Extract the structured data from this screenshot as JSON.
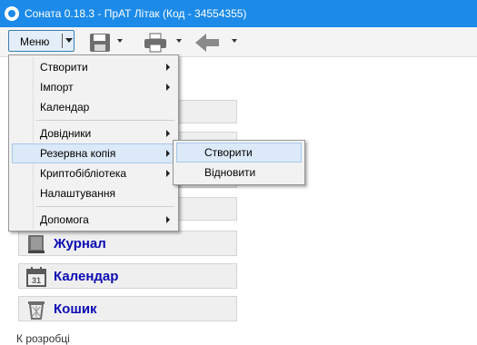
{
  "window": {
    "title": "Соната 0.18.3 - ПрАТ Літак (Код - 34554355)"
  },
  "toolbar": {
    "menu_label": "Меню",
    "icons": [
      "save-icon",
      "print-icon",
      "back-arrow-icon"
    ]
  },
  "panels": [
    {
      "label": "Журнал",
      "icon": "journal-icon"
    },
    {
      "label": "Календар",
      "icon": "calendar-icon"
    },
    {
      "label": "Кошик",
      "icon": "trash-icon"
    }
  ],
  "footer": {
    "text": "К розробці"
  },
  "dropdown_menu": {
    "items": [
      {
        "label": "Створити",
        "has_submenu": true
      },
      {
        "label": "Імпорт",
        "has_submenu": true
      },
      {
        "label": "Календар",
        "has_submenu": false
      },
      {
        "label": "Довідники",
        "has_submenu": true
      },
      {
        "label": "Резервна копія",
        "has_submenu": true,
        "highlighted": true
      },
      {
        "label": "Криптобібліотека",
        "has_submenu": true
      },
      {
        "label": "Налаштування",
        "has_submenu": false
      },
      {
        "label": "Допомога",
        "has_submenu": true
      }
    ]
  },
  "submenu": {
    "items": [
      {
        "label": "Створити",
        "highlighted": true
      },
      {
        "label": "Відновити"
      }
    ]
  },
  "colors": {
    "titlebar": "#1b8ae8",
    "panel_label": "#0b0bb3",
    "highlight": "#dbe9f8"
  }
}
